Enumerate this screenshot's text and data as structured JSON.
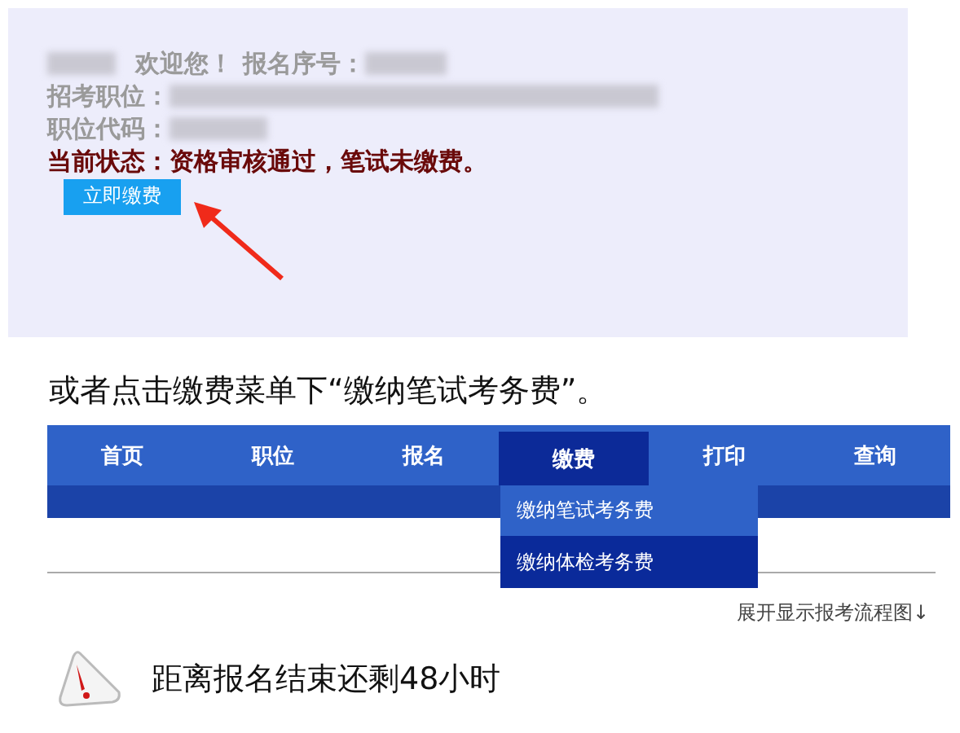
{
  "account_panel": {
    "welcome": "欢迎您！",
    "reg_no_label": "报名序号：",
    "position_label": "招考职位：",
    "position_code_label": "职位代码：",
    "status": "当前状态：资格审核通过，笔试未缴费。",
    "pay_button": "立即缴费"
  },
  "caption": "或者点击缴费菜单下“缴纳笔试考务费”。",
  "nav": {
    "items": [
      {
        "label": "首页",
        "selected": false
      },
      {
        "label": "职位",
        "selected": false
      },
      {
        "label": "报名",
        "selected": false
      },
      {
        "label": "缴费",
        "selected": true
      },
      {
        "label": "打印",
        "selected": false
      },
      {
        "label": "查询",
        "selected": false
      }
    ],
    "dropdown": [
      {
        "label": "缴纳笔试考务费",
        "selected": true
      },
      {
        "label": "缴纳体检考务费",
        "selected": false
      }
    ]
  },
  "flow_link": "展开显示报考流程图↓",
  "countdown": "距离报名结束还剩48小时"
}
